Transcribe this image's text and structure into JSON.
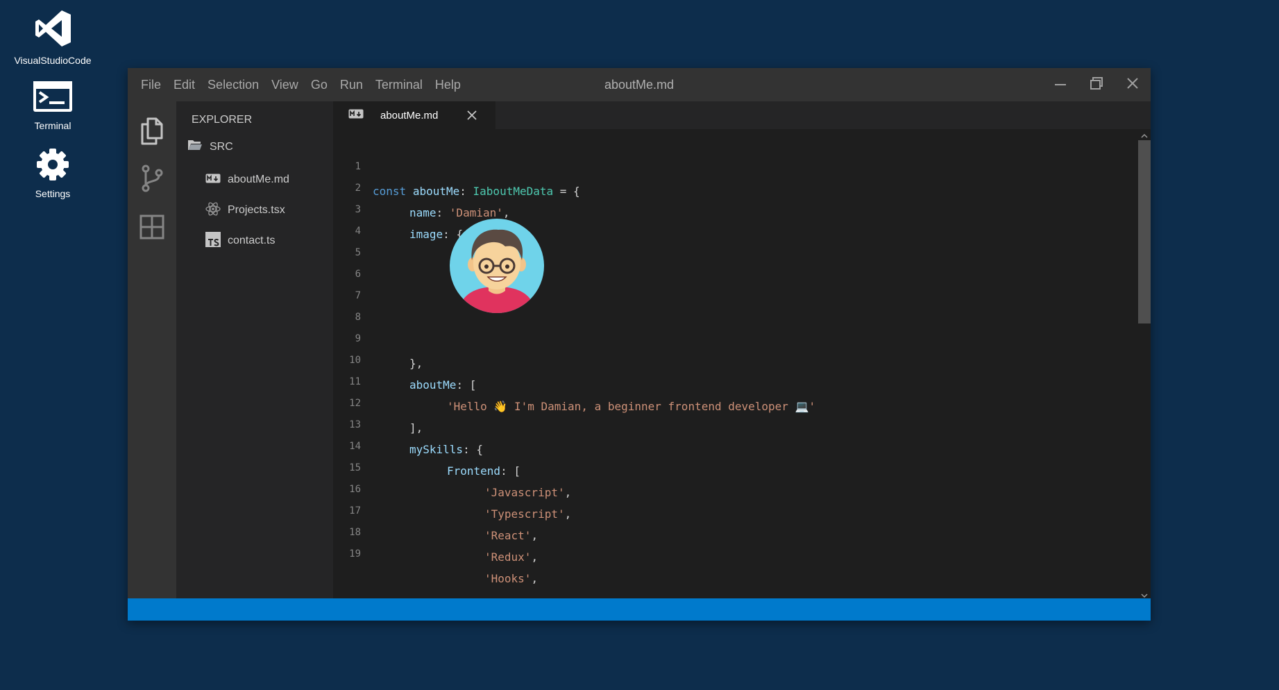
{
  "desktop": {
    "icons": [
      {
        "label": "VisualStudioCode",
        "icon": "vscode-icon"
      },
      {
        "label": "Terminal",
        "icon": "terminal-icon"
      },
      {
        "label": "Settings",
        "icon": "gear-icon"
      }
    ]
  },
  "window": {
    "title": "aboutMe.md",
    "menu": [
      "File",
      "Edit",
      "Selection",
      "View",
      "Go",
      "Run",
      "Terminal",
      "Help"
    ]
  },
  "activity_bar": [
    "files-icon",
    "source-control-icon",
    "extensions-icon"
  ],
  "explorer": {
    "title": "EXPLORER",
    "folder": "SRC",
    "files": [
      {
        "name": "aboutMe.md",
        "icon": "markdown-icon"
      },
      {
        "name": "Projects.tsx",
        "icon": "react-icon"
      },
      {
        "name": "contact.ts",
        "icon": "typescript-icon"
      }
    ]
  },
  "tab": {
    "label": "aboutMe.md",
    "icon": "markdown-icon"
  },
  "editor": {
    "line_numbers": [
      "1",
      "2",
      "3",
      "4",
      "5",
      "6",
      "7",
      "8",
      "9",
      "10",
      "11",
      "12",
      "13",
      "14",
      "15",
      "16",
      "17",
      "18",
      "19"
    ],
    "line1": {
      "kw": "const",
      "name": "aboutMe",
      "colon": ":",
      "type": "IaboutMeData",
      "rest": " = {"
    },
    "line2": {
      "prop": "name",
      "colon": ": ",
      "str": "'Damian'",
      "rest": ","
    },
    "line3": {
      "prop": "image",
      "rest": ": {"
    },
    "line9": {
      "rest": "},"
    },
    "line10": {
      "prop": "aboutMe",
      "rest": ": ["
    },
    "line11": {
      "str": "'Hello 👋 I'm Damian, a beginner frontend developer 💻'"
    },
    "line12": {
      "rest": "],"
    },
    "line13": {
      "prop": "mySkills",
      "rest": ": {"
    },
    "line14": {
      "prop": "Frontend",
      "rest": ": ["
    },
    "line15": {
      "str": "'Javascript'",
      "rest": ","
    },
    "line16": {
      "str": "'Typescript'",
      "rest": ","
    },
    "line17": {
      "str": "'React'",
      "rest": ","
    },
    "line18": {
      "str": "'Redux'",
      "rest": ","
    },
    "line19": {
      "str": "'Hooks'",
      "rest": ","
    }
  },
  "colors": {
    "desktop_bg": "#0d2d4c",
    "statusbar": "#007acc",
    "keyword": "#569cd6",
    "type": "#4ec9b0",
    "property": "#9cdcfe",
    "string": "#ce9178"
  }
}
